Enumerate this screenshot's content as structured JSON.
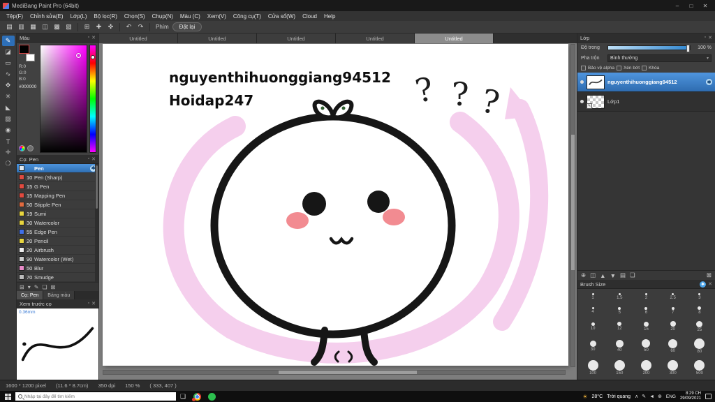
{
  "titlebar": {
    "title": "MediBang Paint Pro (64bit)",
    "minimize": "–",
    "maximize": "□",
    "close": "✕"
  },
  "menu": {
    "items": [
      "Tệp(F)",
      "Chỉnh sửa(E)",
      "Lớp(L)",
      "Bộ lọc(R)",
      "Chọn(S)",
      "Chụp(N)",
      "Màu (C)",
      "Xem(V)",
      "Công cụ(T)",
      "Cửa sổ(W)",
      "Cloud",
      "Help"
    ]
  },
  "toolbar": {
    "icon_groups": [
      [
        {
          "name": "new-file-icon",
          "glyph": "▤"
        },
        {
          "name": "open-file-icon",
          "glyph": "▥"
        },
        {
          "name": "save-file-icon",
          "glyph": "▦"
        },
        {
          "name": "export-icon",
          "glyph": "◫"
        },
        {
          "name": "grid-icon",
          "glyph": "▩"
        },
        {
          "name": "guide-icon",
          "glyph": "▧"
        }
      ],
      [
        {
          "name": "snap-grid-icon",
          "glyph": "⊞"
        },
        {
          "name": "snap-cross-icon",
          "glyph": "✚"
        },
        {
          "name": "snap-radial-icon",
          "glyph": "✜"
        }
      ],
      [
        {
          "name": "undo-icon",
          "glyph": "↶"
        },
        {
          "name": "redo-icon",
          "glyph": "↷"
        }
      ]
    ],
    "phim_label": "Phím",
    "reset_button": "Đặt lại"
  },
  "left_tools": {
    "items": [
      {
        "name": "pen-tool-icon",
        "glyph": "✎"
      },
      {
        "name": "eraser-tool-icon",
        "glyph": "◪"
      },
      {
        "name": "select-tool-icon",
        "glyph": "▭"
      },
      {
        "name": "lasso-tool-icon",
        "glyph": "∿"
      },
      {
        "name": "move-tool-icon",
        "glyph": "✥"
      },
      {
        "name": "magic-wand-tool-icon",
        "glyph": "✳"
      },
      {
        "name": "bucket-tool-icon",
        "glyph": "◣"
      },
      {
        "name": "gradient-tool-icon",
        "glyph": "▨"
      },
      {
        "name": "eyedropper-tool-icon",
        "glyph": "◉"
      },
      {
        "name": "text-tool-icon",
        "glyph": "T"
      },
      {
        "name": "shape-tool-icon",
        "glyph": "✛"
      },
      {
        "name": "hand-tool-icon",
        "glyph": "❍"
      }
    ]
  },
  "icons": {
    "gear": "✱",
    "pen": "✎",
    "panel_min": "▫",
    "panel_close": "✕",
    "dropdown_arrow": "▾"
  },
  "color_panel": {
    "title": "Màu",
    "r": "R:0",
    "g": "G:0",
    "b": "B:0",
    "hex": "#000000"
  },
  "brush_panel": {
    "title": "Cọ: Pen",
    "brushes": [
      {
        "size": "",
        "name": "Pen",
        "chip": "#dfe8f0",
        "selected": true
      },
      {
        "size": "10",
        "name": "Pen (Sharp)",
        "chip": "#e04a3f",
        "selected": false
      },
      {
        "size": "15",
        "name": "G Pen",
        "chip": "#e04a3f",
        "selected": false
      },
      {
        "size": "15",
        "name": "Mapping Pen",
        "chip": "#e04a3f",
        "selected": false
      },
      {
        "size": "50",
        "name": "Stipple Pen",
        "chip": "#e06a3f",
        "selected": false
      },
      {
        "size": "19",
        "name": "Sumi",
        "chip": "#e8d53f",
        "selected": false
      },
      {
        "size": "30",
        "name": "Watercolor",
        "chip": "#e8d53f",
        "selected": false
      },
      {
        "size": "55",
        "name": "Edge Pen",
        "chip": "#3f6fe8",
        "selected": false
      },
      {
        "size": "20",
        "name": "Pencil",
        "chip": "#e8d53f",
        "selected": false
      },
      {
        "size": "20",
        "name": "Airbrush",
        "chip": "#eeeeee",
        "selected": false
      },
      {
        "size": "90",
        "name": "Watercolor (Wet)",
        "chip": "#cccccc",
        "selected": false
      },
      {
        "size": "50",
        "name": "Blur",
        "chip": "#e88ac8",
        "selected": false
      },
      {
        "size": "70",
        "name": "Smudge",
        "chip": "#bbbbbb",
        "selected": false
      }
    ],
    "action_icons": [
      {
        "name": "add-brush-icon",
        "glyph": "⊞"
      },
      {
        "name": "brush-menu-icon",
        "glyph": "▾"
      },
      {
        "name": "edit-brush-icon",
        "glyph": "✎"
      },
      {
        "name": "brush-folder-icon",
        "glyph": "❏"
      },
      {
        "name": "delete-brush-icon",
        "glyph": "⊠"
      }
    ]
  },
  "panel_tabs": {
    "brush": "Cọ: Pen",
    "palette": "Bảng màu"
  },
  "preview_panel": {
    "title": "Xem trước cọ",
    "size_label": "0.36mm"
  },
  "tabs": {
    "items": [
      "Untitled",
      "Untitled",
      "Untitled",
      "Untitled",
      "Untitled"
    ],
    "active_index": 4
  },
  "canvas": {
    "text_line1": "nguyenthihuonggiang94512",
    "text_line2": "Hoidap247",
    "question_mark": "?"
  },
  "layers_panel": {
    "title": "Lớp",
    "opacity_label": "Độ trong",
    "opacity_value": "100 %",
    "blend_label": "Pha trộn",
    "blend_value": "Bình thường",
    "alpha_label": "Bảo vệ alpha",
    "clip_label": "Xén bớt",
    "lock_label": "Khóa",
    "layers": [
      {
        "name": "nguyenthihuonggiang94512",
        "selected": true
      },
      {
        "name": "Lớp1",
        "selected": false
      }
    ],
    "action_icons": [
      {
        "name": "add-layer-icon",
        "glyph": "⊕"
      },
      {
        "name": "duplicate-layer-icon",
        "glyph": "◫"
      },
      {
        "name": "layer-up-icon",
        "glyph": "▲"
      },
      {
        "name": "layer-down-icon",
        "glyph": "▼"
      },
      {
        "name": "merge-layer-icon",
        "glyph": "▤"
      },
      {
        "name": "layer-folder-icon",
        "glyph": "❏"
      },
      {
        "spacer": true
      },
      {
        "name": "delete-layer-icon",
        "glyph": "⊠"
      }
    ]
  },
  "brush_size_panel": {
    "title": "Brush Size",
    "sizes": [
      1,
      1.5,
      2,
      2.5,
      3,
      4,
      5,
      6,
      7,
      8,
      10,
      12,
      15,
      20,
      25,
      30,
      40,
      50,
      60,
      80,
      100,
      150,
      200,
      300,
      500
    ]
  },
  "statusbar": {
    "dimensions": "1600 * 1200 pixel",
    "physical": "(11.6 * 8.7cm)",
    "dpi": "350 dpi",
    "zoom": "150 %",
    "coords": "( 333, 407 )"
  },
  "taskbar": {
    "search_placeholder": "Nhập tại đây để tìm kiếm",
    "weather_temp": "28°C",
    "weather_desc": "Trời quang",
    "tray_icons": [
      {
        "name": "hidden-icons-chevron",
        "glyph": "∧"
      },
      {
        "name": "tablet-pen-icon",
        "glyph": "✎"
      },
      {
        "name": "speaker-icon",
        "glyph": "◄"
      },
      {
        "name": "network-icon",
        "glyph": "⊕"
      }
    ],
    "language": "ENG",
    "time": "8:29 CH",
    "date": "29/09/2021"
  }
}
